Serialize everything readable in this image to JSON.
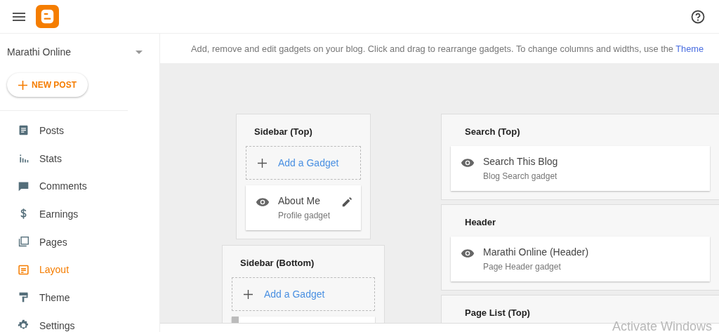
{
  "sidebar": {
    "blog_name": "Marathi Online",
    "new_post": "NEW POST",
    "items": [
      {
        "label": "Posts",
        "selected": false
      },
      {
        "label": "Stats",
        "selected": false
      },
      {
        "label": "Comments",
        "selected": false
      },
      {
        "label": "Earnings",
        "selected": false
      },
      {
        "label": "Pages",
        "selected": false
      },
      {
        "label": "Layout",
        "selected": true
      },
      {
        "label": "Theme",
        "selected": false
      },
      {
        "label": "Settings",
        "selected": false
      }
    ]
  },
  "info": {
    "text": "Add, remove and edit gadgets on your blog. Click and drag to rearrange gadgets. To change columns and widths, use the",
    "link": "Theme"
  },
  "columns": [
    {
      "sections": [
        {
          "title": "Sidebar (Top)",
          "add_gadget": "Add a Gadget",
          "gadgets": [
            {
              "kind": "gadget",
              "name": "About Me",
              "type": "Profile gadget",
              "editable": true
            }
          ]
        },
        {
          "title": "Sidebar (Bottom)",
          "add_gadget": "Add a Gadget",
          "gadgets": [
            {
              "kind": "partial"
            }
          ]
        }
      ]
    },
    {
      "sections": [
        {
          "title": "Search (Top)",
          "gadgets": [
            {
              "kind": "gadget",
              "name": "Search This Blog",
              "type": "Blog Search gadget",
              "editable": false
            }
          ]
        },
        {
          "title": "Header",
          "gadgets": [
            {
              "kind": "gadget",
              "name": "Marathi Online (Header)",
              "type": "Page Header gadget",
              "editable": false
            }
          ]
        },
        {
          "title": "Page List (Top)"
        }
      ]
    }
  ],
  "overlay": "Activate Windows"
}
